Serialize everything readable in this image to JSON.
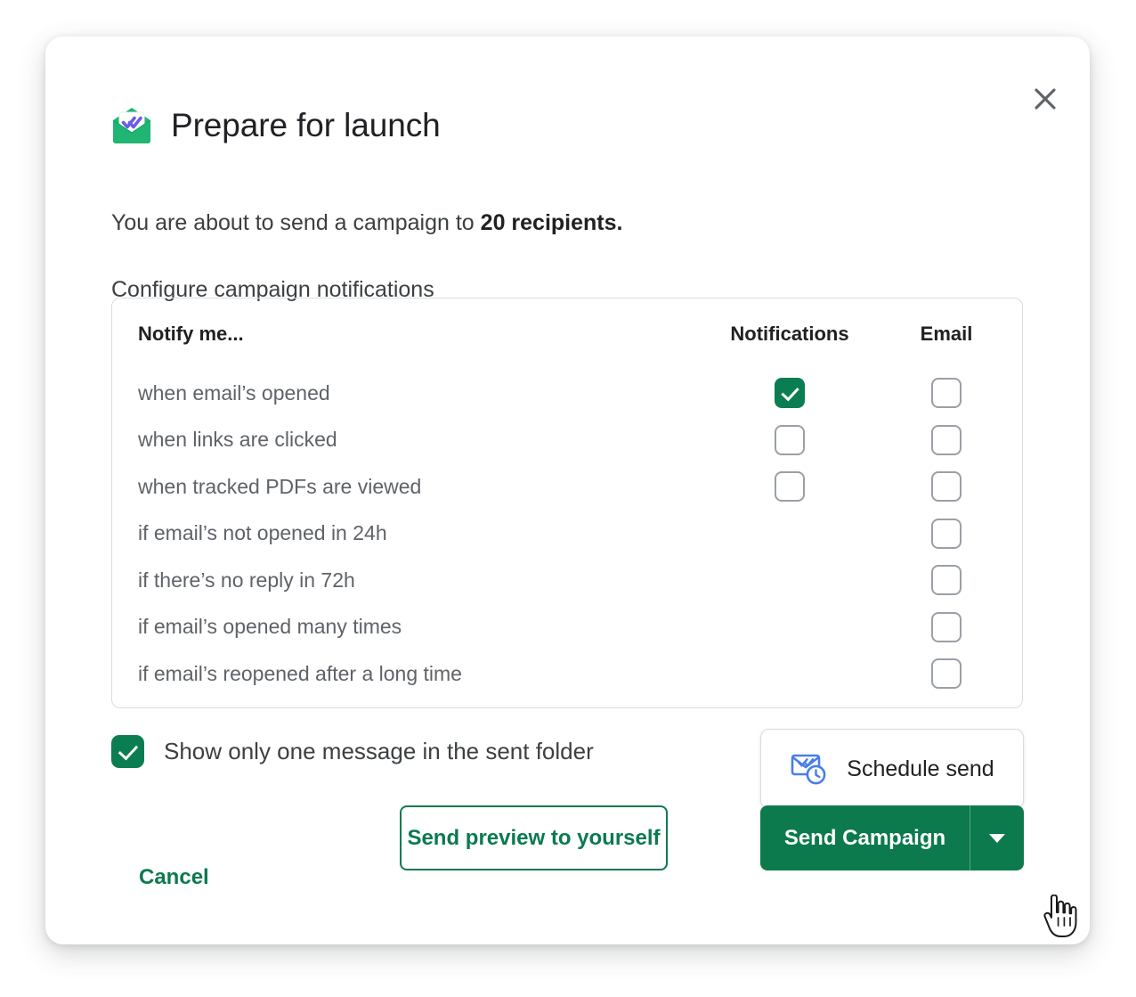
{
  "dialog": {
    "title": "Prepare for launch",
    "brand_icon": "envelope-double-check-icon",
    "close_icon": "close-icon",
    "intro_prefix": "You are about to send a campaign to ",
    "intro_emphasis": "20 recipients.",
    "section_label": "Configure campaign notifications"
  },
  "table": {
    "headers": {
      "label": "Notify me...",
      "notifications": "Notifications",
      "email": "Email"
    },
    "rows": [
      {
        "label": "when email’s opened",
        "notifications": "checked",
        "email": "unchecked"
      },
      {
        "label": "when links are clicked",
        "notifications": "unchecked",
        "email": "unchecked"
      },
      {
        "label": "when tracked PDFs are viewed",
        "notifications": "unchecked",
        "email": "unchecked"
      },
      {
        "label": "if email’s not opened in 24h",
        "notifications": "none",
        "email": "unchecked"
      },
      {
        "label": "if there’s no reply in 72h",
        "notifications": "none",
        "email": "unchecked"
      },
      {
        "label": "if email’s opened many times",
        "notifications": "none",
        "email": "unchecked"
      },
      {
        "label": "if email’s reopened after a long time",
        "notifications": "none",
        "email": "unchecked"
      }
    ]
  },
  "sent_folder_option": {
    "label": "Show only one message in the sent folder",
    "state": "checked"
  },
  "actions": {
    "schedule_send": "Schedule send",
    "schedule_icon": "envelope-clock-icon",
    "cancel": "Cancel",
    "send_preview": "Send preview to yourself",
    "send_campaign": "Send Campaign",
    "send_caret_icon": "chevron-down-icon"
  },
  "cursor": {
    "icon": "pointing-hand-cursor"
  },
  "colors": {
    "brand_green": "#0b7d52",
    "button_green": "#0c7a4d",
    "link_green": "#0b7a4e",
    "icon_blue": "#4a7ee8",
    "border_gray": "#dadce0",
    "checkbox_gray": "#9aa0a6",
    "text_primary": "#202124",
    "text_secondary": "#5f6368"
  }
}
